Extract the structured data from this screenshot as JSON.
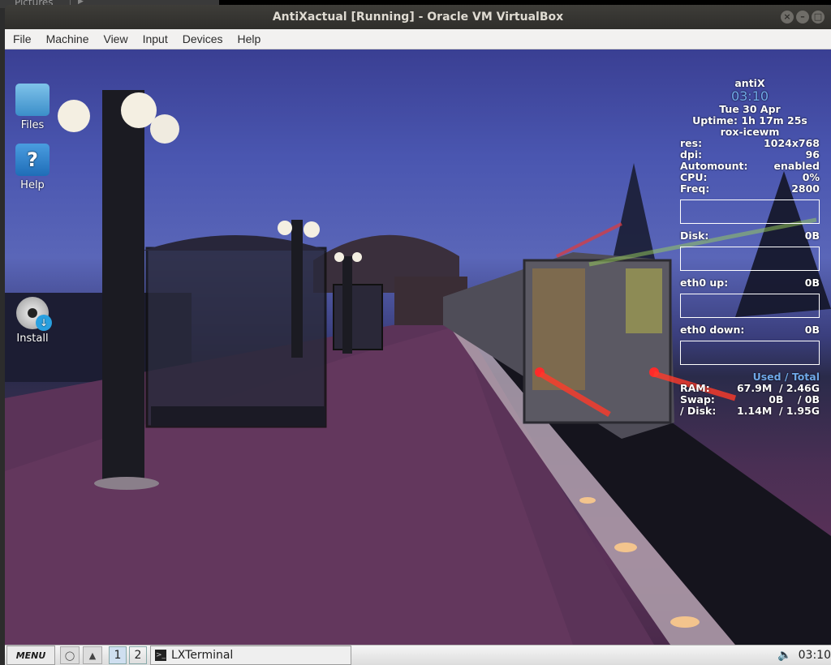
{
  "host": {
    "folder_label": "Pictures"
  },
  "window": {
    "title": "AntiXactual [Running] - Oracle VM VirtualBox",
    "menu": [
      "File",
      "Machine",
      "View",
      "Input",
      "Devices",
      "Help"
    ]
  },
  "desktop": {
    "icons": [
      {
        "label": "Files",
        "icon": "folder-home-icon"
      },
      {
        "label": "Help",
        "icon": "help-question-icon"
      },
      {
        "label": "Install",
        "icon": "install-disc-icon"
      }
    ]
  },
  "conky": {
    "hostname": "antiX",
    "time": "03:10",
    "date": "Tue 30 Apr",
    "uptime": "Uptime: 1h 17m 25s",
    "wm": "rox-icewm",
    "stats": [
      {
        "label": "res:",
        "value": "1024x768"
      },
      {
        "label": "dpi:",
        "value": "96"
      },
      {
        "label": "Automount:",
        "value": "enabled"
      },
      {
        "label": "CPU:",
        "value": "0%"
      },
      {
        "label": "Freq:",
        "value": "2800"
      }
    ],
    "disk": {
      "label": "Disk:",
      "value": "0B"
    },
    "eth_up": {
      "label": "eth0 up:",
      "value": "0B"
    },
    "eth_down": {
      "label": "eth0 down:",
      "value": "0B"
    },
    "mem_header": "Used / Total",
    "mem": [
      {
        "label": "RAM:",
        "value": "67.9M  / 2.46G"
      },
      {
        "label": "Swap:",
        "value": "0B    / 0B"
      },
      {
        "label": "/ Disk:",
        "value": "1.14M  / 1.95G"
      }
    ]
  },
  "taskbar": {
    "menu_label": "MENU",
    "workspaces": [
      "1",
      "2"
    ],
    "task_label": "LXTerminal",
    "clock": "03:10"
  }
}
